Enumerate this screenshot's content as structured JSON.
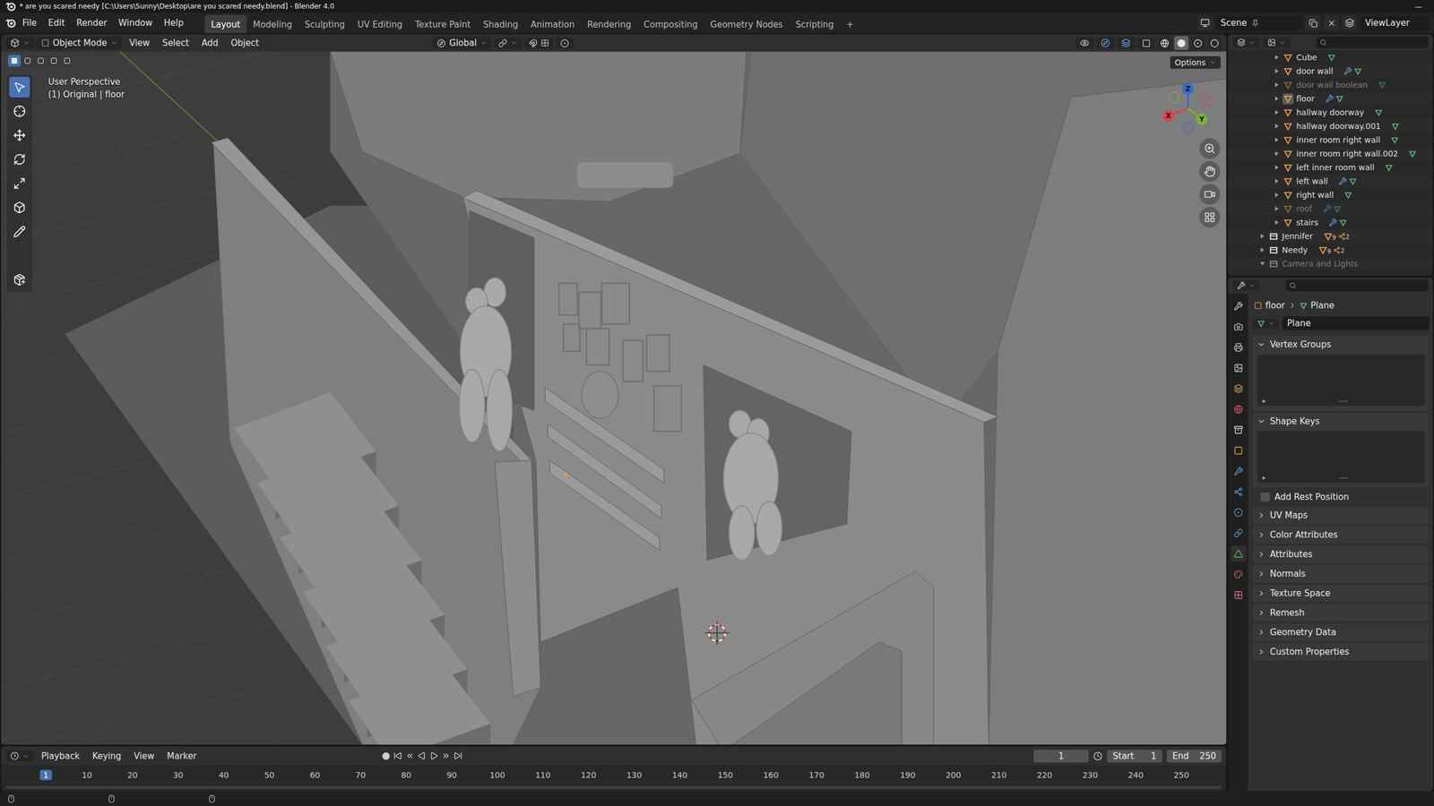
{
  "window": {
    "title": "* are you scared needy [C:\\Users\\Sunny\\Desktop\\are you scared needy.blend] - Blender 4.0",
    "controls": [
      "—"
    ]
  },
  "menus": [
    "File",
    "Edit",
    "Render",
    "Window",
    "Help"
  ],
  "workspaces": [
    {
      "label": "Layout",
      "selected": true
    },
    {
      "label": "Modeling",
      "selected": false
    },
    {
      "label": "Sculpting",
      "selected": false
    },
    {
      "label": "UV Editing",
      "selected": false
    },
    {
      "label": "Texture Paint",
      "selected": false
    },
    {
      "label": "Shading",
      "selected": false
    },
    {
      "label": "Animation",
      "selected": false
    },
    {
      "label": "Rendering",
      "selected": false
    },
    {
      "label": "Compositing",
      "selected": false
    },
    {
      "label": "Geometry Nodes",
      "selected": false
    },
    {
      "label": "Scripting",
      "selected": false
    }
  ],
  "addWorkspace": "+",
  "scene": "Scene",
  "viewLayer": "ViewLayer",
  "viewport": {
    "mode": "Object Mode",
    "menus": [
      "View",
      "Select",
      "Add",
      "Object"
    ],
    "orientation": "Global",
    "options": "Options",
    "info": [
      "User Perspective",
      "(1) Original | floor"
    ],
    "tools": [
      {
        "selected": true
      },
      {
        "selected": false
      },
      {
        "selected": false
      },
      {
        "selected": false
      },
      {
        "selected": false
      },
      {
        "selected": false
      },
      {
        "selected": false
      },
      {
        "selected": false
      },
      {
        "selected": false
      }
    ],
    "selectModes": [
      {
        "selected": true
      },
      {
        "selected": false
      },
      {
        "selected": false
      },
      {
        "selected": false
      },
      {
        "selected": false
      }
    ],
    "shading": [
      {
        "selected": false
      },
      {
        "selected": true
      },
      {
        "selected": false
      },
      {
        "selected": false
      }
    ],
    "gizmo": [
      {
        "label": "Z",
        "color": "#2f6fd6"
      },
      {
        "label": "Y",
        "color": "#7db52f"
      },
      {
        "label": "X",
        "color": "#e0414f"
      }
    ]
  },
  "outliner": {
    "rows": [
      {
        "label": "Cube",
        "kind": "object",
        "expanded": false,
        "dimmed": false,
        "active": false,
        "modifiers": false,
        "badges": []
      },
      {
        "label": "door wall",
        "kind": "object",
        "expanded": false,
        "dimmed": false,
        "active": false,
        "modifiers": true,
        "badges": []
      },
      {
        "label": "door wall boolean",
        "kind": "object",
        "expanded": false,
        "dimmed": true,
        "active": false,
        "modifiers": false,
        "badges": []
      },
      {
        "label": "floor",
        "kind": "object",
        "expanded": false,
        "dimmed": false,
        "active": true,
        "modifiers": true,
        "badges": []
      },
      {
        "label": "hallway doorway",
        "kind": "object",
        "expanded": false,
        "dimmed": false,
        "active": false,
        "modifiers": false,
        "badges": []
      },
      {
        "label": "hallway doorway.001",
        "kind": "object",
        "expanded": false,
        "dimmed": false,
        "active": false,
        "modifiers": false,
        "badges": []
      },
      {
        "label": "inner room right wall",
        "kind": "object",
        "expanded": false,
        "dimmed": false,
        "active": false,
        "modifiers": false,
        "badges": []
      },
      {
        "label": "inner room right wall.002",
        "kind": "object",
        "expanded": false,
        "dimmed": false,
        "active": false,
        "modifiers": false,
        "badges": []
      },
      {
        "label": "left inner room wall",
        "kind": "object",
        "expanded": false,
        "dimmed": false,
        "active": false,
        "modifiers": false,
        "badges": []
      },
      {
        "label": "left wall",
        "kind": "object",
        "expanded": false,
        "dimmed": false,
        "active": false,
        "modifiers": true,
        "badges": []
      },
      {
        "label": "right wall",
        "kind": "object",
        "expanded": false,
        "dimmed": false,
        "active": false,
        "modifiers": false,
        "badges": []
      },
      {
        "label": "roof",
        "kind": "object",
        "expanded": false,
        "dimmed": true,
        "active": false,
        "modifiers": true,
        "badges": []
      },
      {
        "label": "stairs",
        "kind": "object",
        "expanded": false,
        "dimmed": false,
        "active": false,
        "modifiers": true,
        "badges": []
      },
      {
        "label": "Jennifer",
        "kind": "collection",
        "expanded": false,
        "dimmed": false,
        "active": false,
        "modifiers": false,
        "badges": [
          "9",
          "2"
        ]
      },
      {
        "label": "Needy",
        "kind": "collection",
        "expanded": false,
        "dimmed": false,
        "active": false,
        "modifiers": false,
        "badges": [
          "9",
          "2"
        ]
      },
      {
        "label": "Camera and Lights",
        "kind": "collection",
        "expanded": true,
        "dimmed": true,
        "active": false,
        "modifiers": false,
        "badges": []
      }
    ]
  },
  "properties": {
    "tabs": [
      {
        "selected": false
      },
      {
        "selected": false
      },
      {
        "selected": false
      },
      {
        "selected": false
      },
      {
        "selected": false
      },
      {
        "selected": false
      },
      {
        "selected": false
      },
      {
        "selected": false
      },
      {
        "selected": false
      },
      {
        "selected": false
      },
      {
        "selected": false
      },
      {
        "selected": false
      },
      {
        "selected": true
      },
      {
        "selected": false
      },
      {
        "selected": false
      }
    ],
    "object": "floor",
    "data": "Plane",
    "datablock": "Plane",
    "panels": [
      {
        "label": "Vertex Groups",
        "kind": "list",
        "expanded": true,
        "checked": false
      },
      {
        "label": "Shape Keys",
        "kind": "list",
        "expanded": true,
        "checked": false
      },
      {
        "label": "Add Rest Position",
        "kind": "checkbox",
        "expanded": false,
        "checked": false
      },
      {
        "label": "UV Maps",
        "kind": "panel",
        "expanded": false,
        "checked": false
      },
      {
        "label": "Color Attributes",
        "kind": "panel",
        "expanded": false,
        "checked": false
      },
      {
        "label": "Attributes",
        "kind": "panel",
        "expanded": false,
        "checked": false
      },
      {
        "label": "Normals",
        "kind": "panel",
        "expanded": false,
        "checked": false
      },
      {
        "label": "Texture Space",
        "kind": "panel",
        "expanded": false,
        "checked": false
      },
      {
        "label": "Remesh",
        "kind": "panel",
        "expanded": false,
        "checked": false
      },
      {
        "label": "Geometry Data",
        "kind": "panel",
        "expanded": false,
        "checked": false
      },
      {
        "label": "Custom Properties",
        "kind": "panel",
        "expanded": false,
        "checked": false
      }
    ]
  },
  "timeline": {
    "menus": [
      "Playback",
      "Keying",
      "View",
      "Marker"
    ],
    "frame": "1",
    "startLabel": "Start",
    "start": "1",
    "endLabel": "End",
    "end": "250",
    "current": "1",
    "ticks": [
      "1",
      "10",
      "20",
      "30",
      "40",
      "50",
      "60",
      "70",
      "80",
      "90",
      "100",
      "110",
      "120",
      "130",
      "140",
      "150",
      "160",
      "170",
      "180",
      "190",
      "200",
      "210",
      "220",
      "230",
      "240",
      "250"
    ]
  }
}
